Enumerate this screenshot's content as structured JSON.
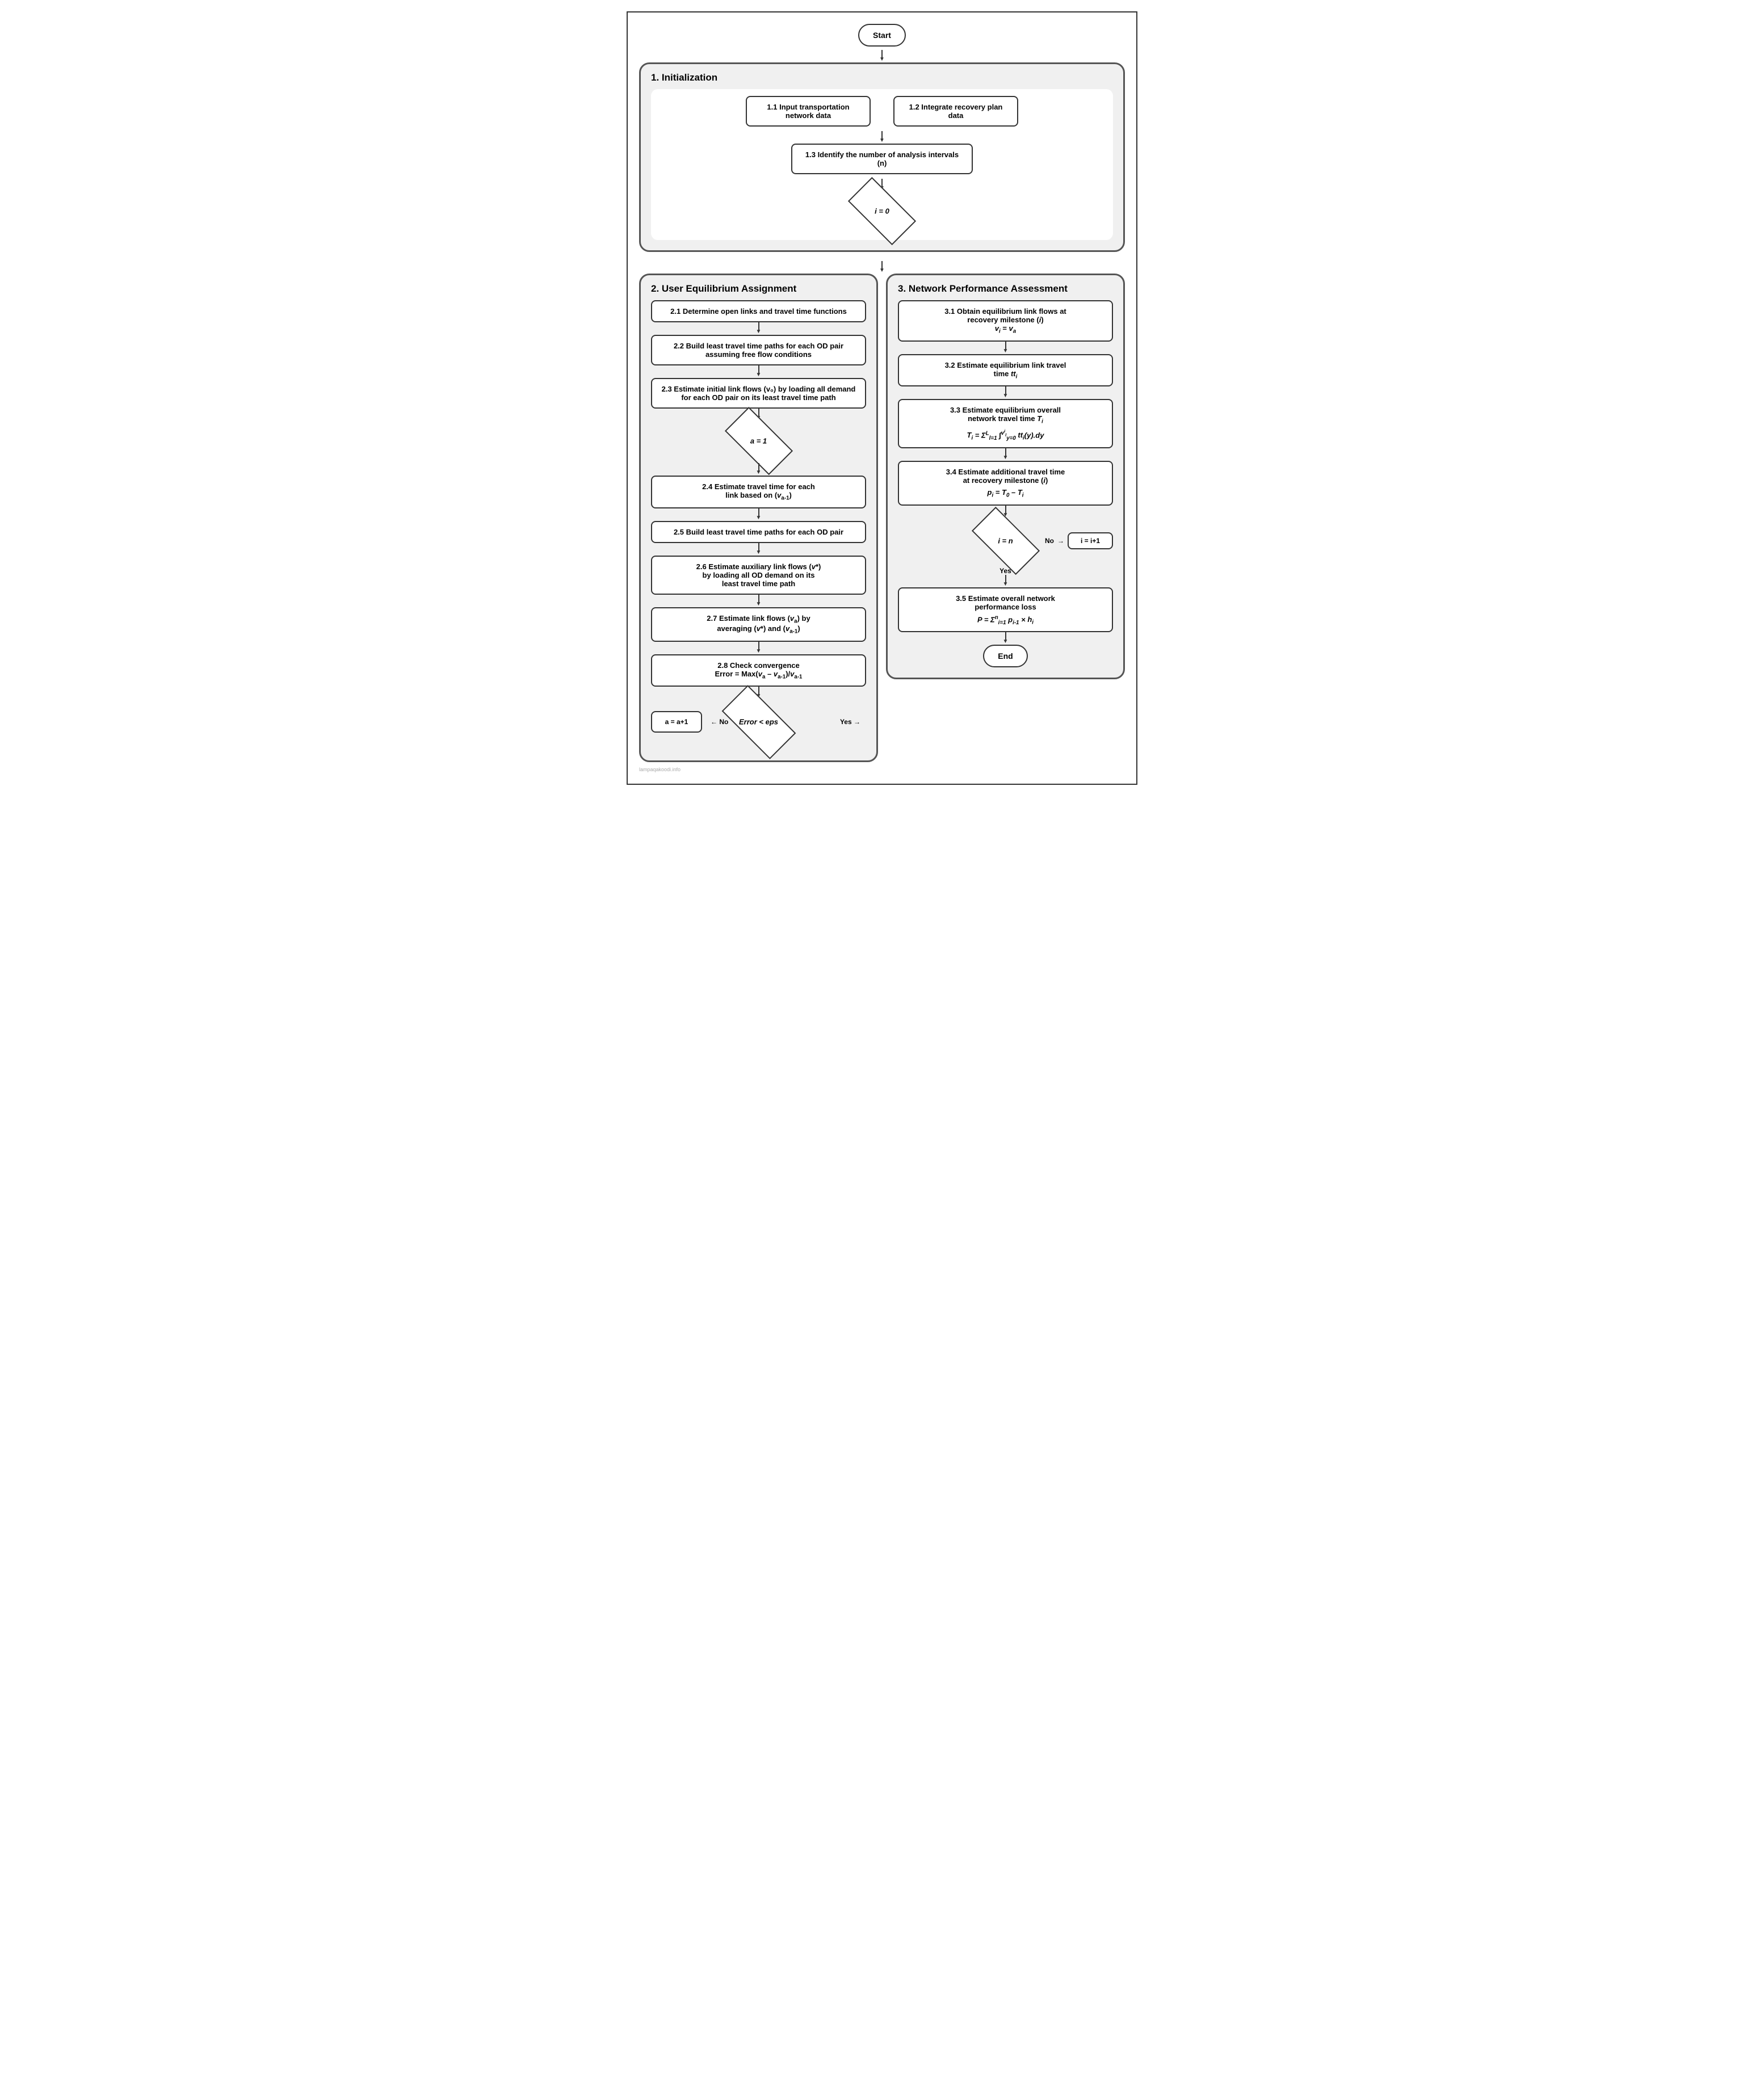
{
  "start_label": "Start",
  "end_label": "End",
  "section1": {
    "title": "1.   Initialization",
    "box11": "1.1  Input transportation\nnetwork data",
    "box12": "1.2  Integrate recovery plan\ndata",
    "box13": "1.3  Identify the number of\nanalysis intervals (n)",
    "diamond_i0": "i = 0"
  },
  "section2": {
    "title": "2.   User Equilibrium Assignment",
    "box21": "2.1  Determine open links and travel\ntime functions",
    "box22": "2.2  Build least travel time paths for\neach OD pair assuming free flow\nconditions",
    "box23": "2.3  Estimate initial link flows (v₀) by\nloading all demand for each OD pair\non its least travel time path",
    "diamond_a1": "a = 1",
    "box24": "2.4  Estimate travel time for each\nlink based on (v a-1)",
    "box25": "2.5  Build least travel time paths for\neach OD pair",
    "box26": "2.6  Estimate auxiliary link flows (v*)\nby loading all OD demand on its\nleast travel time path",
    "box27": "2.7  Estimate link flows (vₐ) by\naveraging (v*) and (v a-1)",
    "box28": "2.8  Check convergence\nError = Max(vₐ – v a-1)/v a-1",
    "diamond_eps": "Error < eps",
    "box_a_plus": "a = a+1",
    "label_no": "No",
    "label_yes": "Yes"
  },
  "section3": {
    "title": "3.   Network Performance Assessment",
    "box31": "3.1  Obtain equilibrium link flows at\nrecovery milestone (i)\nv i = v a",
    "box32": "3.2  Estimate equilibrium link travel\ntime tt i",
    "box33": "3.3  Estimate equilibrium overall\nnetwork travel time T i",
    "formula33": "T i = Σ ∫ tt i(y).dy",
    "box34": "3.4  Estimate additional travel time\nat recovery milestone (i)",
    "formula34": "p i = T₀ – T i",
    "diamond_in": "i = n",
    "label_no": "No",
    "label_yes": "Yes",
    "box_i_plus": "i = i+1",
    "box35": "3.5  Estimate overall network\nperformance loss",
    "formula35": "P = Σ p i-1 × h i"
  },
  "watermark": "lampaqakoodi.info"
}
